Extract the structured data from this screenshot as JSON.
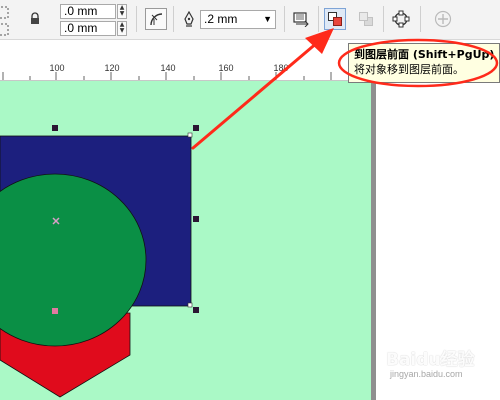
{
  "toolbar": {
    "position_x": ".0 mm",
    "position_y": ".0 mm",
    "outline_width": ".2 mm"
  },
  "ruler": {
    "ticks": [
      "100",
      "120",
      "140",
      "160",
      "180"
    ]
  },
  "tooltip": {
    "title": "到图层前面 (Shift+PgUp)",
    "description": "将对象移到图层前面。"
  },
  "watermark": {
    "text": "Baidu经验",
    "url": "jingyan.baidu.com"
  },
  "colors": {
    "canvas": "#aaf9c6",
    "rectangle": "#1c1f7e",
    "circle": "#0a8f45",
    "hexagon": "#e00b1c",
    "annotation": "#ff2a1a",
    "handles": "#2b1633"
  }
}
